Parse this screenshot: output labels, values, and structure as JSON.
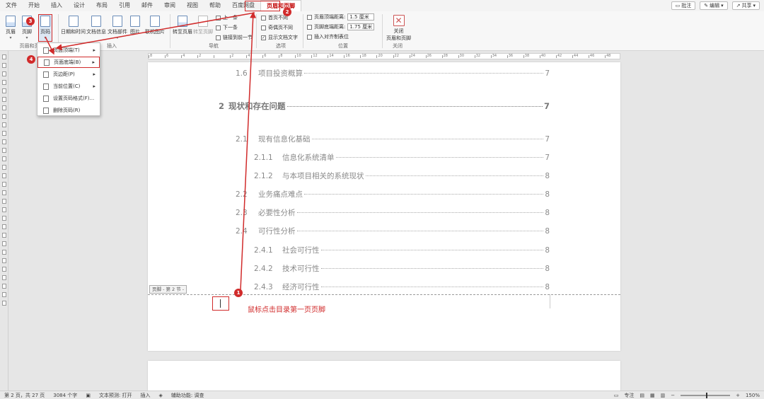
{
  "menubar": {
    "tabs": [
      "文件",
      "开始",
      "插入",
      "设计",
      "布局",
      "引用",
      "邮件",
      "审阅",
      "视图",
      "帮助",
      "百度网盘",
      "页眉和页脚"
    ],
    "active_tab": "页眉和页脚",
    "comment_label": "批注",
    "edit_label": "编辑",
    "share_label": "共享"
  },
  "ribbon": {
    "header_label": "页眉",
    "footer_label": "页脚",
    "page_number_label": "页码",
    "group_hf": "页眉和页脚",
    "datetime_label": "日期和时间",
    "docinfo_label": "文档信息",
    "docparts_label": "文档部件",
    "picture_label": "图片",
    "online_picture_label": "联机图片",
    "group_insert": "插入",
    "goto_header_label": "转至页眉",
    "goto_footer_label": "转至页脚",
    "prev_label": "上一条",
    "next_label": "下一条",
    "link_prev_label": "链接到前一节",
    "group_nav": "导航",
    "first_page_diff": "首页不同",
    "odd_even_diff": "奇偶页不同",
    "show_doc_text": "显示文档文字",
    "group_options": "选项",
    "header_top_label": "页眉顶端距离:",
    "header_top_value": "1.5 厘米",
    "footer_bottom_label": "页脚底端距离:",
    "footer_bottom_value": "1.75 厘米",
    "insert_align_tab": "插入对齐制表位",
    "group_position": "位置",
    "close_label": "关闭\n页眉和页脚",
    "close_label_1": "关闭",
    "close_label_2": "页眉和页脚",
    "group_close": "关闭"
  },
  "dropdown": {
    "items": [
      {
        "label": "页面顶端(T)",
        "submenu": true
      },
      {
        "label": "页面底端(B)",
        "submenu": true
      },
      {
        "label": "页边距(P)",
        "submenu": true
      },
      {
        "label": "当前位置(C)",
        "submenu": true
      },
      {
        "label": "设置页码格式(F)...",
        "submenu": false
      },
      {
        "label": "删除页码(R)",
        "submenu": false
      }
    ]
  },
  "document": {
    "toc": [
      {
        "num": "1.6",
        "title": "项目投资概算",
        "page": "7"
      },
      {
        "num": "2",
        "title": "现状和存在问题",
        "page": "7"
      },
      {
        "num": "2.1",
        "title": "现有信息化基础",
        "page": "7"
      },
      {
        "num": "2.1.1",
        "title": "信息化系统清单",
        "page": "7"
      },
      {
        "num": "2.1.2",
        "title": "与本项目相关的系统现状",
        "page": "8"
      },
      {
        "num": "2.2",
        "title": "业务痛点难点",
        "page": "8"
      },
      {
        "num": "2.3",
        "title": "必要性分析",
        "page": "8"
      },
      {
        "num": "2.4",
        "title": "可行性分析",
        "page": "8"
      },
      {
        "num": "2.4.1",
        "title": "社会可行性",
        "page": "8"
      },
      {
        "num": "2.4.2",
        "title": "技术可行性",
        "page": "8"
      },
      {
        "num": "2.4.3",
        "title": "经济可行性",
        "page": "8"
      }
    ],
    "footer_label": "页脚 - 第 2 节 -",
    "hint": "鼠标点击目录第一页页脚"
  },
  "annotations": {
    "badges": [
      "1",
      "2",
      "3",
      "4"
    ],
    "color": "#d12b2b"
  },
  "ruler": {
    "numbers": [
      "8",
      "6",
      "4",
      "2",
      "",
      "2",
      "4",
      "6",
      "8",
      "10",
      "12",
      "14",
      "16",
      "18",
      "20",
      "22",
      "24",
      "26",
      "28",
      "30",
      "32",
      "34",
      "36",
      "38",
      "40",
      "42",
      "44",
      "46",
      "48"
    ]
  },
  "statusbar": {
    "page": "第 2 页，共 27 页",
    "words": "3084 个字",
    "predict": "文本预测: 打开",
    "insert": "插入",
    "access": "辅助功能: 调查",
    "focus": "专注",
    "zoom": "150%"
  }
}
